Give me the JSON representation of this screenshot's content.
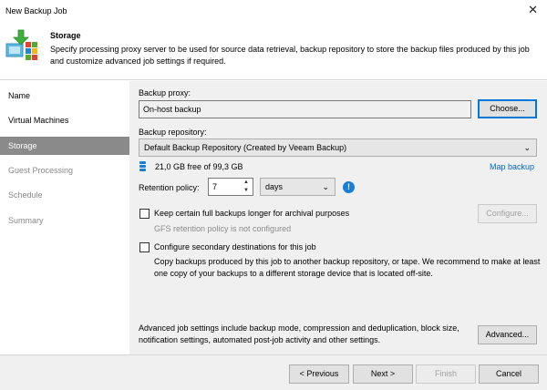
{
  "window": {
    "title": "New Backup Job",
    "close_glyph": "✕"
  },
  "header": {
    "title": "Storage",
    "description": "Specify processing proxy server to be used for source data retrieval, backup repository to store the backup files produced by this job and customize advanced job settings if required."
  },
  "sidebar": {
    "items": [
      {
        "label": "Name",
        "state": "normal"
      },
      {
        "label": "Virtual Machines",
        "state": "normal"
      },
      {
        "label": "Storage",
        "state": "active"
      },
      {
        "label": "Guest Processing",
        "state": "disabled"
      },
      {
        "label": "Schedule",
        "state": "disabled"
      },
      {
        "label": "Summary",
        "state": "disabled"
      }
    ]
  },
  "storage": {
    "proxy_label": "Backup proxy:",
    "proxy_value": "On-host backup",
    "choose_label": "Choose...",
    "repo_label": "Backup repository:",
    "repo_value": "Default Backup Repository (Created by Veeam Backup)",
    "repo_free": "21,0 GB free of 99,3 GB",
    "map_backup": "Map backup",
    "retention_label": "Retention policy:",
    "retention_value": "7",
    "retention_unit": "days",
    "gfs_checkbox_label": "Keep certain full backups longer for archival purposes",
    "gfs_status": "GFS retention policy is not configured",
    "configure_label": "Configure...",
    "secondary_label": "Configure secondary destinations for this job",
    "secondary_desc": "Copy backups produced by this job to another backup repository, or tape. We recommend to make at least one copy of your backups to a different storage device that is located off-site.",
    "advanced_desc": "Advanced job settings include backup mode, compression and deduplication, block size, notification settings, automated post-job activity and other settings.",
    "advanced_label": "Advanced..."
  },
  "footer": {
    "previous": "< Previous",
    "next": "Next >",
    "finish": "Finish",
    "cancel": "Cancel"
  },
  "colors": {
    "accent": "#0078d7",
    "link": "#0066cc",
    "sidebar_active": "#8a8a8a",
    "info_icon": "#1a7fd4"
  }
}
